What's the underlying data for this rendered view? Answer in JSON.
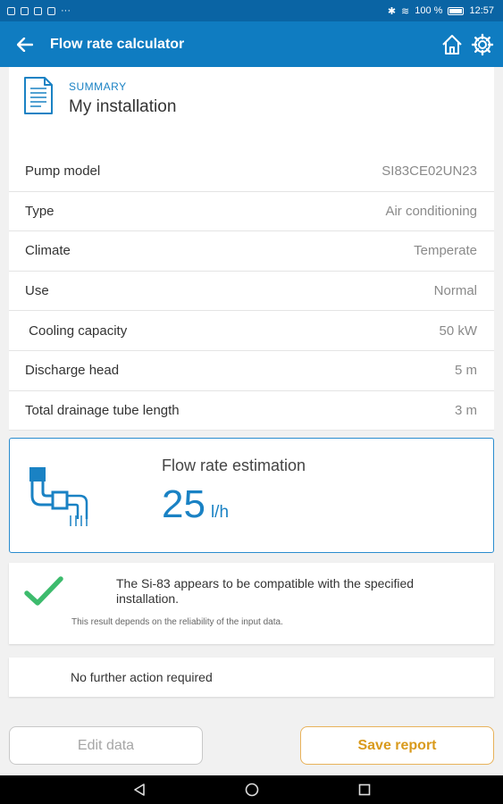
{
  "status_bar": {
    "battery": "100 %",
    "time": "12:57"
  },
  "app_bar": {
    "title": "Flow rate calculator"
  },
  "summary": {
    "label": "SUMMARY",
    "name": "My installation"
  },
  "rows": [
    {
      "key": "Pump model",
      "value": "SI83CE02UN23"
    },
    {
      "key": "Type",
      "value": "Air conditioning"
    },
    {
      "key": "Climate",
      "value": "Temperate"
    },
    {
      "key": "Use",
      "value": "Normal"
    },
    {
      "key": " Cooling capacity",
      "value": "50 kW"
    },
    {
      "key": "Discharge head",
      "value": "5 m"
    },
    {
      "key": "Total drainage tube length",
      "value": "3 m"
    }
  ],
  "flow": {
    "title": "Flow rate estimation",
    "value": "25",
    "unit": "l/h"
  },
  "compat": {
    "message": "The Si-83 appears to be compatible with the specified installation.",
    "note": "This result depends on the reliability of the input data."
  },
  "action_text": "No further action required",
  "buttons": {
    "edit": "Edit data",
    "save": "Save report"
  },
  "colors": {
    "primary": "#0f7cc1",
    "status_bar": "#0a64a4",
    "accent_blue": "#1a82c4",
    "check_green": "#3dbb6d",
    "save_orange": "#d99a1c"
  }
}
